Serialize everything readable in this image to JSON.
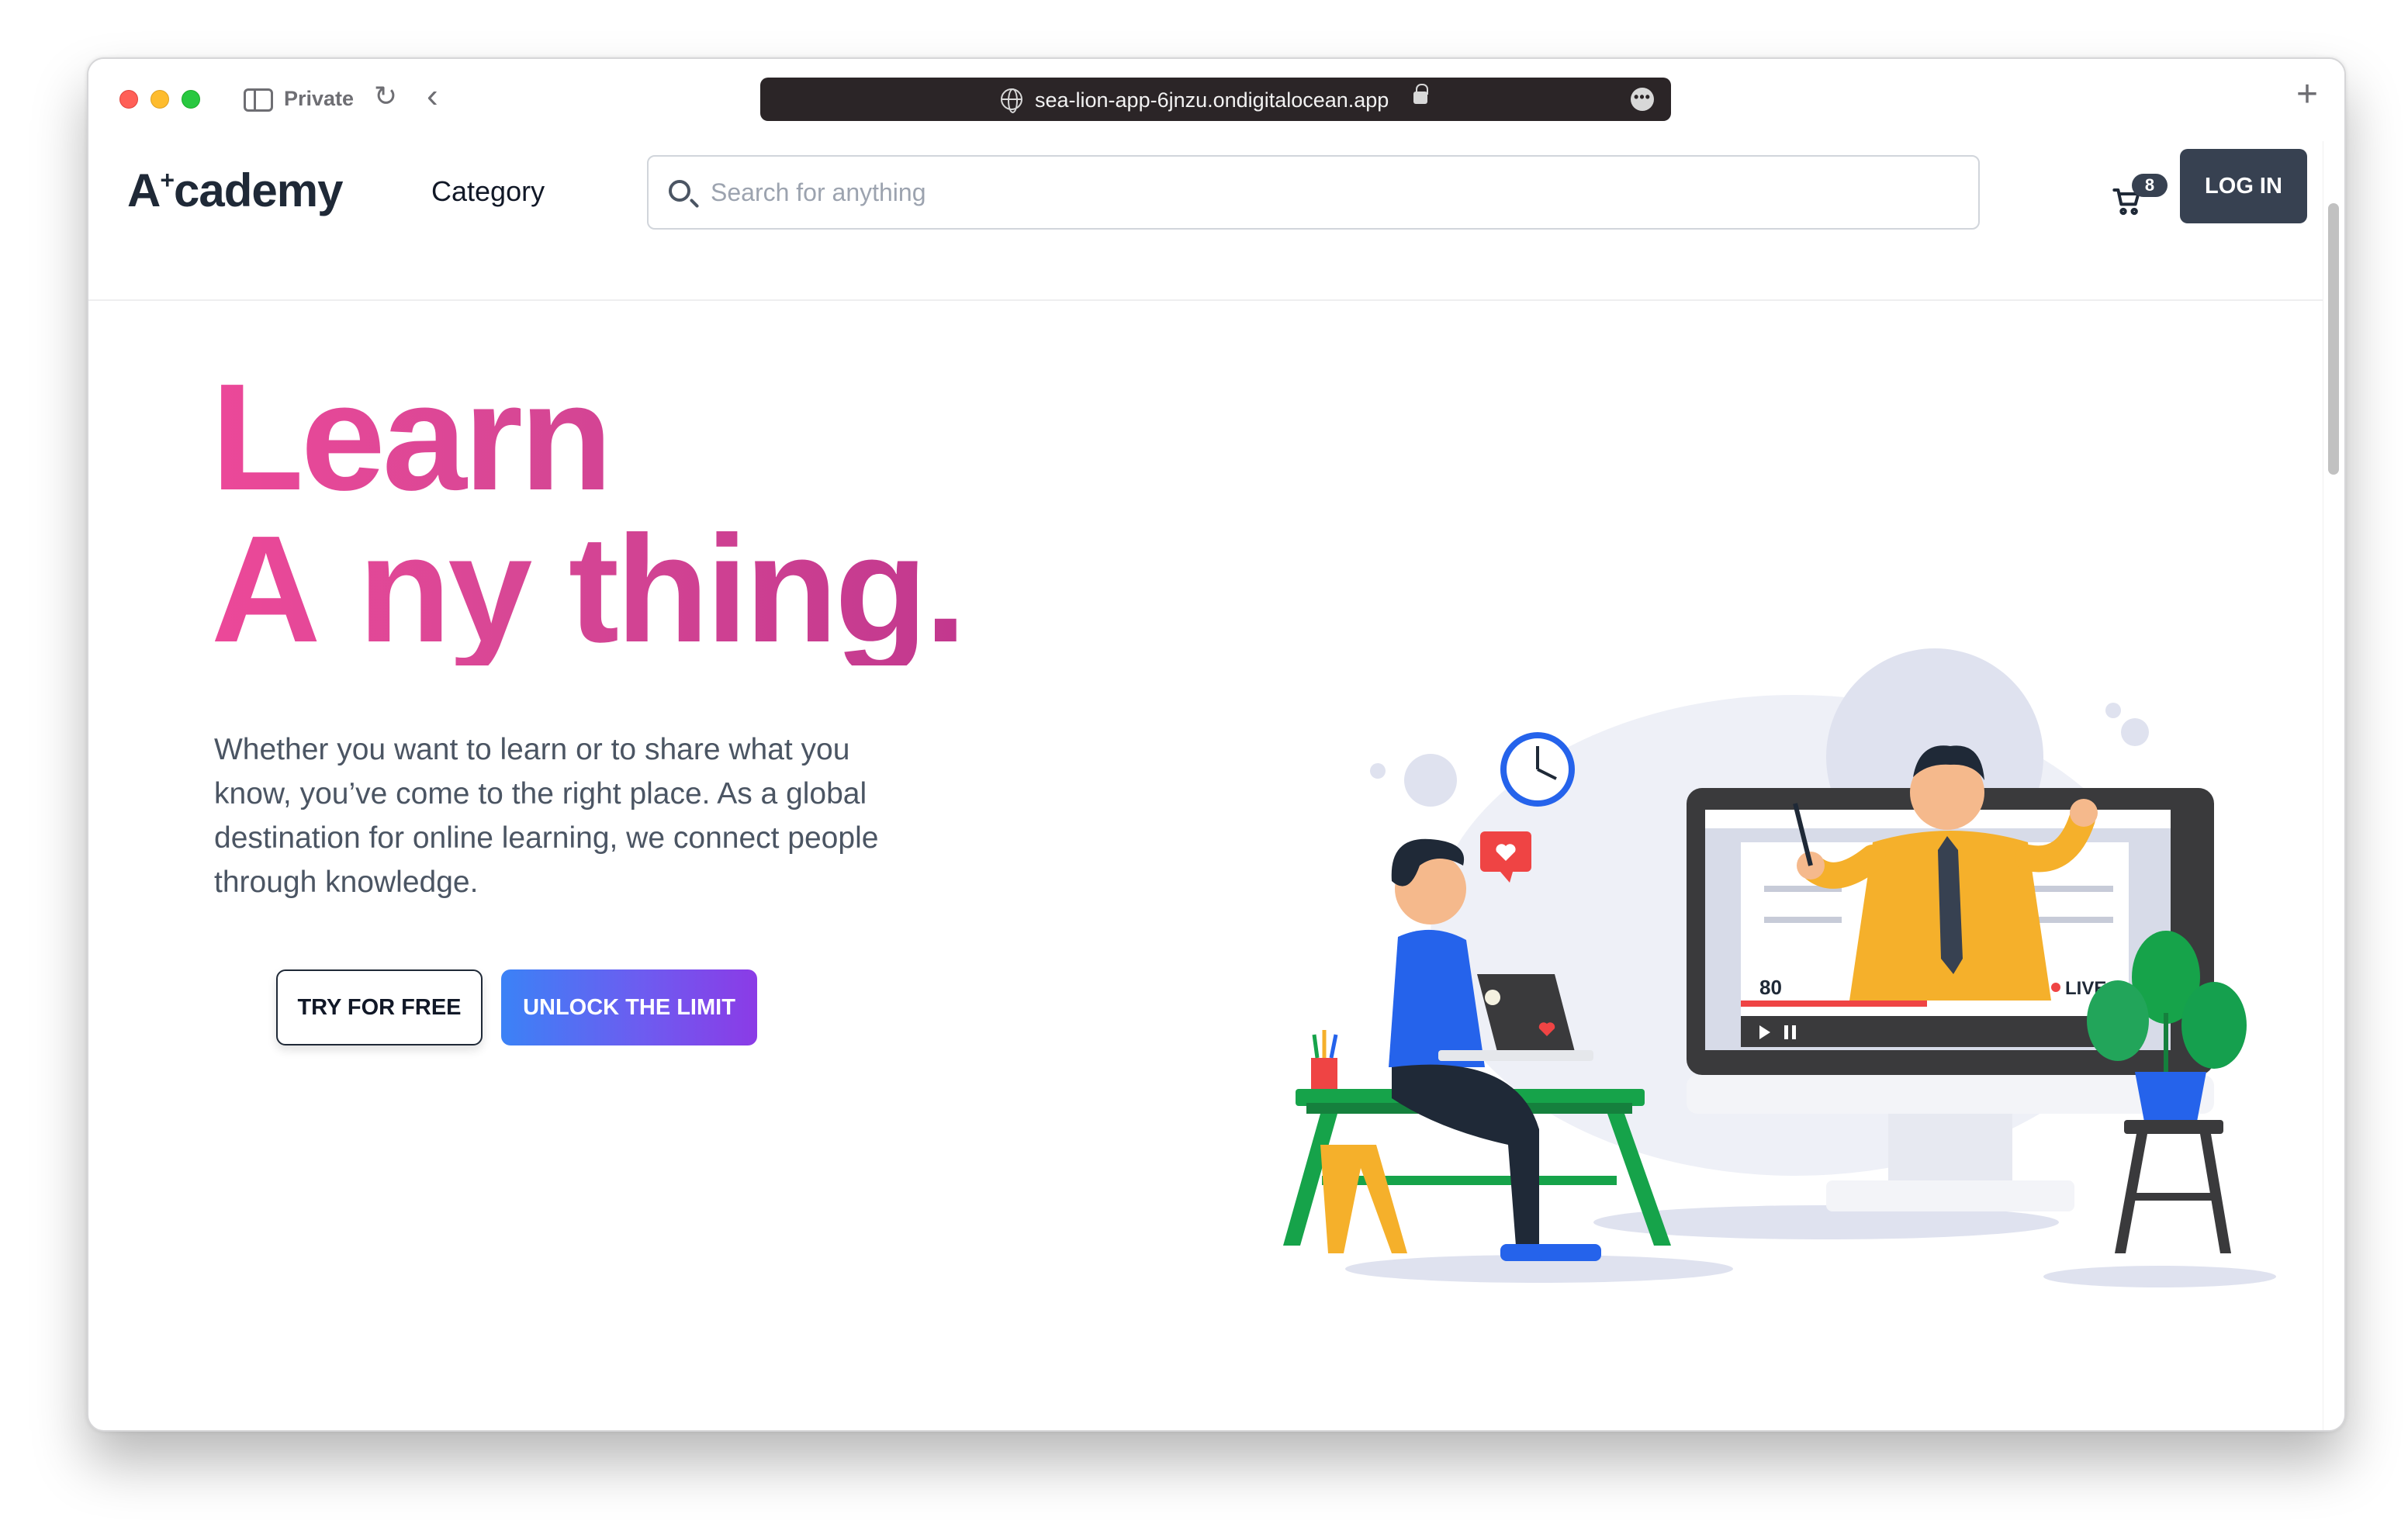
{
  "browser": {
    "private_label": "Private",
    "url": "sea-lion-app-6jnzu.ondigitalocean.app",
    "more_label": "•••",
    "new_tab_label": "+"
  },
  "header": {
    "brand_prefix": "A",
    "brand_sup": "+",
    "brand_suffix": "cademy",
    "category_label": "Category",
    "search_placeholder": "Search for anything",
    "cart_count": "8",
    "login_label": "LOG IN"
  },
  "hero": {
    "title_line1": "Learn",
    "title_line2_prefix": "A",
    "title_line2_sup": "+",
    "title_line2_suffix": "ny thing.",
    "description": "Whether you want to learn or to share what you know, you’ve come to the right place. As a global destination for online learning, we connect people through knowledge.",
    "try_label": "TRY FOR FREE",
    "unlock_label": "UNLOCK THE LIMIT"
  },
  "illustration": {
    "viewer_count": "80",
    "live_label": "LIVE"
  },
  "colors": {
    "accent_pink": "#ec4899",
    "dark_button": "#374151",
    "gradient_start": "#3b82f6",
    "gradient_end": "#8b3be6"
  }
}
